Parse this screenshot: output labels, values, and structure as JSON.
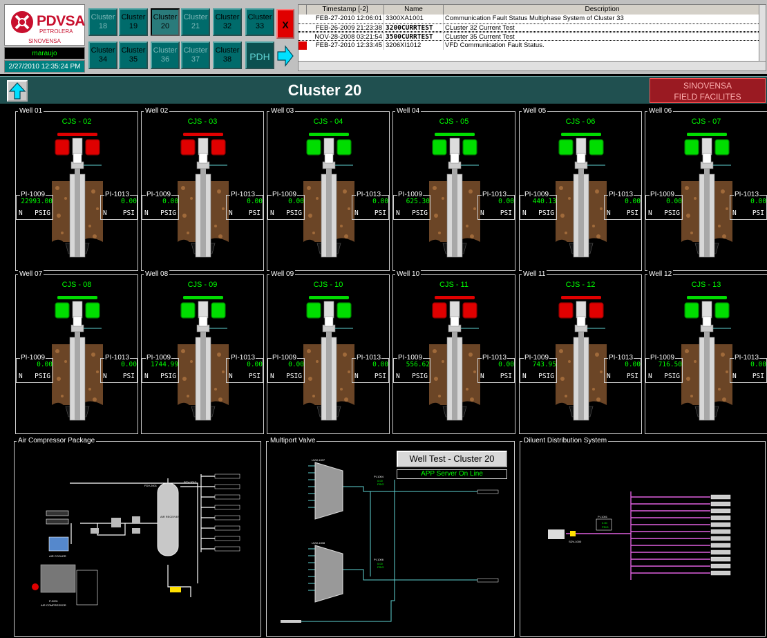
{
  "header": {
    "logo": {
      "brand": "PDVSA",
      "line1": "PETROLERA",
      "line2": "SINOVENSA"
    },
    "user": "maraujo",
    "datetime": "2/27/2010 12:35:24 PM",
    "clusters": [
      {
        "label": "Cluster",
        "num": "18",
        "state": "dim"
      },
      {
        "label": "Cluster",
        "num": "19",
        "state": "normal"
      },
      {
        "label": "Cluster",
        "num": "20",
        "state": "active"
      },
      {
        "label": "Cluster",
        "num": "21",
        "state": "dim"
      },
      {
        "label": "Cluster",
        "num": "32",
        "state": "normal"
      },
      {
        "label": "Cluster",
        "num": "33",
        "state": "normal"
      },
      {
        "label": "Cluster",
        "num": "34",
        "state": "normal"
      },
      {
        "label": "Cluster",
        "num": "35",
        "state": "normal"
      },
      {
        "label": "Cluster",
        "num": "36",
        "state": "dim"
      },
      {
        "label": "Cluster",
        "num": "37",
        "state": "dim"
      },
      {
        "label": "Cluster",
        "num": "38",
        "state": "normal"
      }
    ],
    "close_label": "X",
    "pdh_label": "PDH",
    "arrow_icon": "right-arrow-icon"
  },
  "alarms": {
    "columns": {
      "timestamp": "Timestamp [-2]",
      "name": "Name",
      "description": "Description"
    },
    "rows": [
      {
        "timestamp": "FEB-27-2010 12:06:01",
        "name": "3300XA1001",
        "description": "Communication Fault Status Multiphase System of Cluster 33",
        "flag": false,
        "selected": false
      },
      {
        "timestamp": "FEB-26-2009 21:23:38",
        "name": "3200CURRTEST",
        "description": "CLuster 32 Current Test",
        "flag": false,
        "selected": true
      },
      {
        "timestamp": "NOV-28-2008 03:21:54",
        "name": "3500CURRTEST",
        "description": "CLuster 35 Current Test",
        "flag": false,
        "selected": true
      },
      {
        "timestamp": "FEB-27-2010 12:33:45",
        "name": "3206XI1012",
        "description": "VFD Communication Fault Status.",
        "flag": true,
        "selected": false
      }
    ]
  },
  "title": "Cluster 20",
  "company_box": {
    "line1": "SINOVENSA",
    "line2": "FIELD FACILITES"
  },
  "wells": [
    {
      "label": "Well 01",
      "name": "CJS - 02",
      "status": "red",
      "pi1009_label": "PI-1009",
      "pi1009": "22993.00",
      "pi1009_unit": "PSIG",
      "pi1013_label": "PI-1013",
      "pi1013": "0.00",
      "pi1013_unit": "PSI",
      "mode": "N"
    },
    {
      "label": "Well 02",
      "name": "CJS - 03",
      "status": "red",
      "pi1009_label": "PI-1009",
      "pi1009": "0.00",
      "pi1009_unit": "PSIG",
      "pi1013_label": "PI-1013",
      "pi1013": "0.00",
      "pi1013_unit": "PSI",
      "mode": "N"
    },
    {
      "label": "Well 03",
      "name": "CJS - 04",
      "status": "green",
      "pi1009_label": "PI-1009",
      "pi1009": "0.00",
      "pi1009_unit": "PSIG",
      "pi1013_label": "PI-1013",
      "pi1013": "0.00",
      "pi1013_unit": "PSI",
      "mode": "N"
    },
    {
      "label": "Well 04",
      "name": "CJS - 05",
      "status": "green",
      "pi1009_label": "PI-1009",
      "pi1009": "625.30",
      "pi1009_unit": "PSIG",
      "pi1013_label": "PI-1013",
      "pi1013": "0.00",
      "pi1013_unit": "PSI",
      "mode": "N"
    },
    {
      "label": "Well 05",
      "name": "CJS - 06",
      "status": "green",
      "pi1009_label": "PI-1009",
      "pi1009": "440.13",
      "pi1009_unit": "PSIG",
      "pi1013_label": "PI-1013",
      "pi1013": "0.00",
      "pi1013_unit": "PSI",
      "mode": "N"
    },
    {
      "label": "Well 06",
      "name": "CJS - 07",
      "status": "green",
      "pi1009_label": "PI-1009",
      "pi1009": "0.00",
      "pi1009_unit": "PSIG",
      "pi1013_label": "PI-1013",
      "pi1013": "0.00",
      "pi1013_unit": "PSI",
      "mode": "N"
    },
    {
      "label": "Well 07",
      "name": "CJS - 08",
      "status": "green",
      "pi1009_label": "PI-1009",
      "pi1009": "0.00",
      "pi1009_unit": "PSIG",
      "pi1013_label": "PI-1013",
      "pi1013": "0.00",
      "pi1013_unit": "PSI",
      "mode": "N"
    },
    {
      "label": "Well 08",
      "name": "CJS - 09",
      "status": "green",
      "pi1009_label": "PI-1009",
      "pi1009": "1744.99",
      "pi1009_unit": "PSIG",
      "pi1013_label": "PI-1013",
      "pi1013": "0.00",
      "pi1013_unit": "PSI",
      "mode": "N"
    },
    {
      "label": "Well 09",
      "name": "CJS - 10",
      "status": "green",
      "pi1009_label": "PI-1009",
      "pi1009": "0.00",
      "pi1009_unit": "PSIG",
      "pi1013_label": "PI-1013",
      "pi1013": "0.00",
      "pi1013_unit": "PSI",
      "mode": "N"
    },
    {
      "label": "Well 10",
      "name": "CJS - 11",
      "status": "red",
      "pi1009_label": "PI-1009",
      "pi1009": "556.62",
      "pi1009_unit": "PSIG",
      "pi1013_label": "PI-1013",
      "pi1013": "0.00",
      "pi1013_unit": "PSI",
      "mode": "N"
    },
    {
      "label": "Well 11",
      "name": "CJS - 12",
      "status": "red",
      "pi1009_label": "PI-1009",
      "pi1009": "743.95",
      "pi1009_unit": "PSIG",
      "pi1013_label": "PI-1013",
      "pi1013": "0.00",
      "pi1013_unit": "PSI",
      "mode": "N"
    },
    {
      "label": "Well 12",
      "name": "CJS - 13",
      "status": "green",
      "pi1009_label": "PI-1009",
      "pi1009": "716.50",
      "pi1009_unit": "PSIG",
      "pi1013_label": "PI-1013",
      "pi1013": "0.00",
      "pi1013_unit": "PSI",
      "mode": "N"
    }
  ],
  "panels": {
    "air": {
      "label": "Air Compressor Package",
      "tags": {
        "receiver": "AIR RECEIVER V-2005",
        "air_cooler": "AIR COOLER",
        "compressor": "AIR COMPRESSOR",
        "compressor_tag": "P-2001",
        "fdv": "FDV-2001",
        "pcv": "PCV-2017"
      }
    },
    "multiport": {
      "label": "Multiport Valve",
      "title": "Well Test - Cluster 20",
      "status": "APP Server On Line",
      "valve1": "UVM-1007",
      "valve2": "UVM-1008",
      "pi1": "PI-1004",
      "pi2": "PI-1006",
      "pi_val": "0.00",
      "pi_unit": "PSIG"
    },
    "diluent": {
      "label": "Diluent Distribution System",
      "pi": "PI-1001",
      "pi_val": "0.00",
      "pi_unit": "PSIG",
      "valve": "SDV-1000"
    }
  },
  "colors": {
    "teal": "#205050",
    "green_on": "#00ff00",
    "red_off": "#e00000"
  }
}
